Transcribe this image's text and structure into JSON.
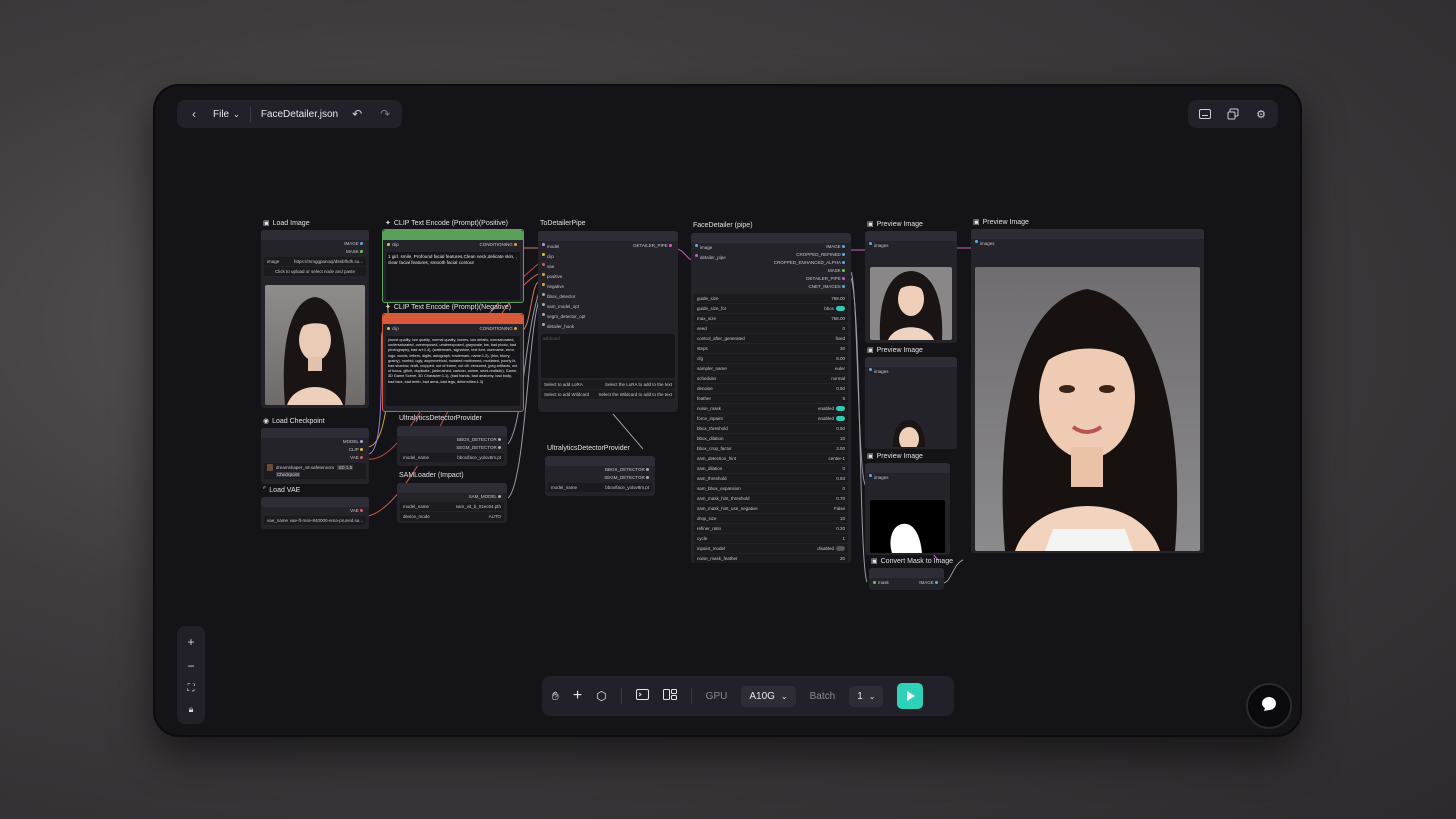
{
  "topbar": {
    "file_label": "File",
    "filename": "FaceDetailer.json"
  },
  "nodes": {
    "load_image": {
      "title": "Load Image",
      "out_image": "IMAGE",
      "out_mask": "MASK",
      "image_label": "image",
      "image_value": "https://mmggpanoqi/d5sbfhdh.su...",
      "upload_label": "Click to upload or select node and paste"
    },
    "clip_pos": {
      "title": "CLIP Text Encode (Prompt)(Positive)",
      "in_clip": "clip",
      "out": "CONDITIONING",
      "text": "1 girl, smile, Profound facial features,Clean neck,delicate skin, , clear facial features, smooth facial contour"
    },
    "clip_neg": {
      "title": "CLIP Text Encode (Prompt)(Negative)",
      "in_clip": "clip",
      "out": "CONDITIONING",
      "text": "(worst quality, low quality, normal quality, lowres, low details, oversaturated, undersaturated, overexposed, underexposed, grayscale, bw, bad photo, bad photography, bad art:1.4), (watermark, signature, text font, username, error, logo, words, letters, digits, autograph, trademark, name:1.2), (blur, blurry, grainy), morbid, ugly, asymmetrical, mutated malformed, mutilated, poorly lit, bad shadow, draft, cropped, out of frame, cut off, censored, jpeg artifacts, out of focus, glitch, duplicate, (airbrushed, cartoon, anime, semi-realistic), Game, 3D Game Scene, 3D Character:1.1), (bad hands, bad anatomy, bad body, bad face, bad teeth, bad arms, bad legs, deformities:1.3)"
    },
    "to_detailer": {
      "title": "ToDetailerPipe",
      "inputs": [
        "model",
        "clip",
        "vae",
        "positive",
        "negative",
        "bbox_detector",
        "sam_model_opt",
        "segm_detector_opt",
        "detailer_hook"
      ],
      "out": "DETAILER_PIPE",
      "wildcard_placeholder": "wildcard",
      "lora_label": "Select to add LoRA",
      "lora_value": "Select the LoRA to add to the text",
      "wild_label": "Select to add Wildcard",
      "wild_value": "Select the Wildcard to add to the text"
    },
    "face_detailer": {
      "title": "FaceDetailer (pipe)",
      "inputs": [
        "image",
        "detailer_pipe"
      ],
      "outputs": [
        "IMAGE",
        "CROPPED_REFINED",
        "CROPPED_ENHANCED_ALPHA",
        "MASK",
        "DETAILER_PIPE",
        "CNET_IMAGES"
      ],
      "params": [
        [
          "guide_size",
          "768.00"
        ],
        [
          "guide_size_for",
          "bbox"
        ],
        [
          "max_size",
          "768.00"
        ],
        [
          "seed",
          "0"
        ],
        [
          "control_after_generated",
          "fixed"
        ],
        [
          "steps",
          "30"
        ],
        [
          "cfg",
          "8.00"
        ],
        [
          "sampler_name",
          "euler"
        ],
        [
          "scheduler",
          "normal"
        ],
        [
          "denoise",
          "0.50"
        ],
        [
          "feather",
          "5"
        ],
        [
          "noise_mask",
          "enabled"
        ],
        [
          "force_inpaint",
          "enabled"
        ],
        [
          "bbox_threshold",
          "0.50"
        ],
        [
          "bbox_dilation",
          "10"
        ],
        [
          "bbox_crop_factor",
          "3.00"
        ],
        [
          "sam_detection_hint",
          "center-1"
        ],
        [
          "sam_dilation",
          "0"
        ],
        [
          "sam_threshold",
          "0.93"
        ],
        [
          "sam_bbox_expansion",
          "0"
        ],
        [
          "sam_mask_hint_threshold",
          "0.70"
        ],
        [
          "sam_mask_hint_use_negative",
          "False"
        ],
        [
          "drop_size",
          "10"
        ],
        [
          "refiner_ratio",
          "0.20"
        ],
        [
          "cycle",
          "1"
        ],
        [
          "inpaint_model",
          "disabled"
        ],
        [
          "noise_mask_feather",
          "20"
        ]
      ]
    },
    "preview1": {
      "title": "Preview Image",
      "in": "images"
    },
    "preview2": {
      "title": "Preview Image",
      "in": "images"
    },
    "preview3": {
      "title": "Preview Image",
      "in": "images"
    },
    "preview_big": {
      "title": "Preview Image",
      "in": "images"
    },
    "convert_mask": {
      "title": "Convert Mask to Image",
      "in": "mask",
      "out": "IMAGE"
    },
    "load_checkpoint": {
      "title": "Load Checkpoint",
      "outs": [
        "MODEL",
        "CLIP",
        "VAE"
      ],
      "ckpt": "dreamshaper_v8.safetensors",
      "tags": [
        "SD 1.5",
        "Checkpoint"
      ]
    },
    "load_vae": {
      "title": "Load VAE",
      "out": "VAE",
      "label": "vae_name",
      "value": "vae-ft-mse-840000-ema-pruned.sa..."
    },
    "ultra1": {
      "title": "UltralyticsDetectorProvider",
      "outs": [
        "BBOX_DETECTOR",
        "SEGM_DETECTOR"
      ],
      "label": "model_name",
      "value": "bbox/face_yolov8m.pt"
    },
    "ultra2": {
      "title": "UltralyticsDetectorProvider",
      "outs": [
        "BBOX_DETECTOR",
        "SEGM_DETECTOR"
      ],
      "label": "model_name",
      "value": "bbox/face_yolov8m.pt"
    },
    "sam_loader": {
      "title": "SAMLoader (Impact)",
      "out": "SAM_MODEL",
      "model_label": "model_name",
      "model_value": "sam_vit_b_01ec64.pth",
      "device_label": "device_mode",
      "device_value": "AUTO"
    }
  },
  "bottombar": {
    "gpu_label": "GPU",
    "gpu_value": "A10G",
    "batch_label": "Batch",
    "batch_value": "1"
  },
  "colors": {
    "accent": "#2fd1b9",
    "positive": "#5aa05a",
    "negative": "#d85a3a"
  }
}
